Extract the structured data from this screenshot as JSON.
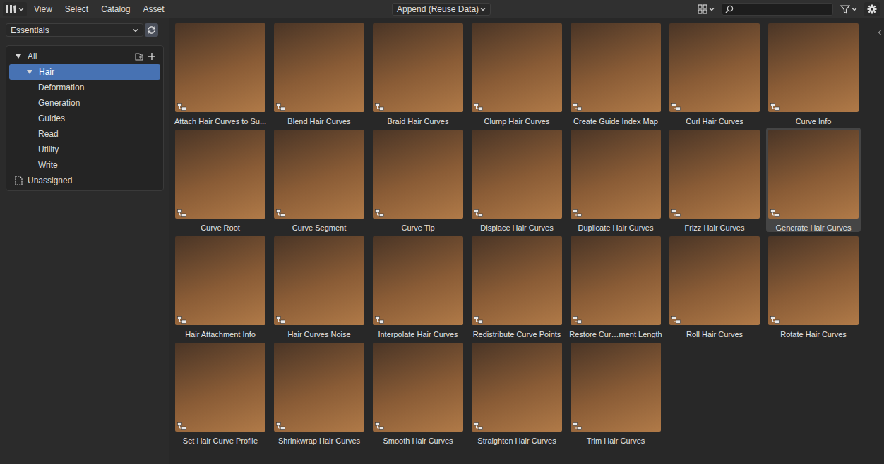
{
  "header": {
    "menus": [
      {
        "label": "View"
      },
      {
        "label": "Select"
      },
      {
        "label": "Catalog"
      },
      {
        "label": "Asset"
      }
    ],
    "import_method": "Append (Reuse Data)"
  },
  "sidebar": {
    "library": "Essentials",
    "catalogs": [
      {
        "label": "All",
        "kind": "root",
        "depth": 0,
        "expanded": true,
        "selected": false
      },
      {
        "label": "Hair",
        "kind": "catalog",
        "depth": 1,
        "expanded": true,
        "selected": true
      },
      {
        "label": "Deformation",
        "kind": "catalog",
        "depth": 2,
        "expanded": false,
        "selected": false
      },
      {
        "label": "Generation",
        "kind": "catalog",
        "depth": 2,
        "expanded": false,
        "selected": false
      },
      {
        "label": "Guides",
        "kind": "catalog",
        "depth": 2,
        "expanded": false,
        "selected": false
      },
      {
        "label": "Read",
        "kind": "catalog",
        "depth": 2,
        "expanded": false,
        "selected": false
      },
      {
        "label": "Utility",
        "kind": "catalog",
        "depth": 2,
        "expanded": false,
        "selected": false
      },
      {
        "label": "Write",
        "kind": "catalog",
        "depth": 2,
        "expanded": false,
        "selected": false
      },
      {
        "label": "Unassigned",
        "kind": "unassigned",
        "depth": 0,
        "expanded": false,
        "selected": false
      }
    ]
  },
  "assets": [
    {
      "label": "Attach Hair Curves to Su...",
      "selected": false
    },
    {
      "label": "Blend Hair Curves",
      "selected": false
    },
    {
      "label": "Braid Hair Curves",
      "selected": false
    },
    {
      "label": "Clump Hair Curves",
      "selected": false
    },
    {
      "label": "Create Guide Index Map",
      "selected": false
    },
    {
      "label": "Curl Hair Curves",
      "selected": false
    },
    {
      "label": "Curve Info",
      "selected": false
    },
    {
      "label": "Curve Root",
      "selected": false
    },
    {
      "label": "Curve Segment",
      "selected": false
    },
    {
      "label": "Curve Tip",
      "selected": false
    },
    {
      "label": "Displace Hair Curves",
      "selected": false
    },
    {
      "label": "Duplicate Hair Curves",
      "selected": false
    },
    {
      "label": "Frizz Hair Curves",
      "selected": false
    },
    {
      "label": "Generate Hair Curves",
      "selected": true
    },
    {
      "label": "Hair Attachment Info",
      "selected": false
    },
    {
      "label": "Hair Curves Noise",
      "selected": false
    },
    {
      "label": "Interpolate Hair Curves",
      "selected": false
    },
    {
      "label": "Redistribute Curve Points",
      "selected": false
    },
    {
      "label": "Restore Cur…ment Length",
      "selected": false
    },
    {
      "label": "Roll Hair Curves",
      "selected": false
    },
    {
      "label": "Rotate Hair Curves",
      "selected": false
    },
    {
      "label": "Set Hair Curve Profile",
      "selected": false
    },
    {
      "label": "Shrinkwrap Hair Curves",
      "selected": false
    },
    {
      "label": "Smooth Hair Curves",
      "selected": false
    },
    {
      "label": "Straighten Hair Curves",
      "selected": false
    },
    {
      "label": "Trim Hair Curves",
      "selected": false
    }
  ]
}
